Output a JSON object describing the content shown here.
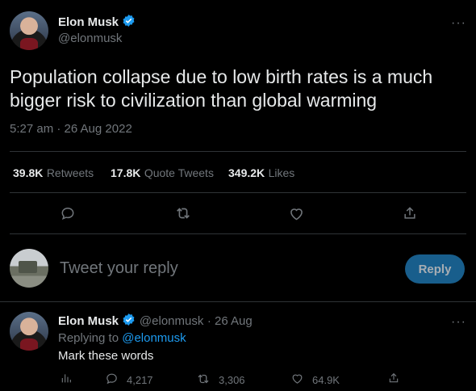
{
  "tweet": {
    "author_name": "Elon Musk",
    "author_handle": "@elonmusk",
    "text": "Population collapse due to low birth rates is a much bigger risk to civilization than global warming",
    "timestamp": "5:27 am · 26 Aug 2022",
    "stats": {
      "retweets_count": "39.8K",
      "retweets_label": "Retweets",
      "quote_count": "17.8K",
      "quote_label": "Quote Tweets",
      "likes_count": "349.2K",
      "likes_label": "Likes"
    }
  },
  "composer": {
    "placeholder": "Tweet your reply",
    "reply_button": "Reply"
  },
  "reply": {
    "author_name": "Elon Musk",
    "author_handle": "@elonmusk",
    "date": "· 26 Aug",
    "replying_to_prefix": "Replying to ",
    "replying_to_handle": "@elonmusk",
    "text": "Mark these words",
    "comments": "4,217",
    "retweets": "3,306",
    "likes": "64.9K"
  },
  "more_glyph": "···",
  "colors": {
    "background": "#000000",
    "accent": "#1d9bf0",
    "muted": "#71767b",
    "text": "#e7e9ea"
  }
}
